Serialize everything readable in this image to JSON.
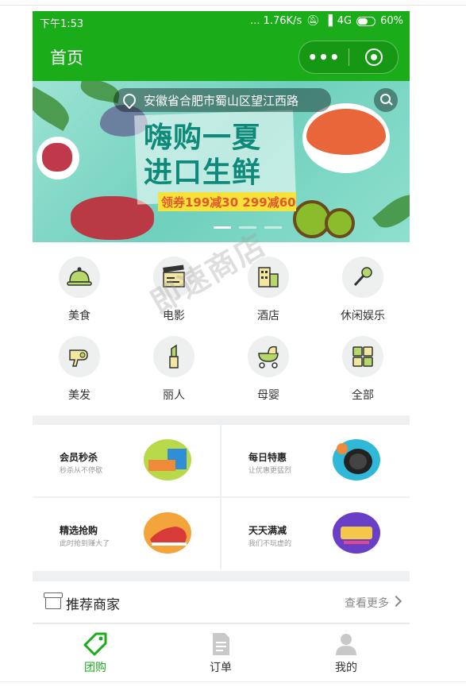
{
  "status_bar": {
    "time": "下午1:53",
    "signal_text": "... 1.76K/s",
    "network": "4G",
    "battery": "60%"
  },
  "nav": {
    "title": "首页",
    "more_label": "•••"
  },
  "banner": {
    "location": "安徽省合肥市蜀山区望江西路",
    "headline_line1": "嗨购一夏",
    "headline_line2": "进口生鲜",
    "coupon": "领券199减30  299减60"
  },
  "categories": [
    {
      "label": "美食",
      "icon": "food-cloche-icon"
    },
    {
      "label": "电影",
      "icon": "movie-clapper-icon"
    },
    {
      "label": "酒店",
      "icon": "hotel-building-icon"
    },
    {
      "label": "休闲娱乐",
      "icon": "microphone-icon"
    },
    {
      "label": "美发",
      "icon": "hairdryer-icon"
    },
    {
      "label": "丽人",
      "icon": "lipstick-icon"
    },
    {
      "label": "母婴",
      "icon": "stroller-icon"
    },
    {
      "label": "全部",
      "icon": "grid-icon"
    }
  ],
  "promos": [
    {
      "title": "会员秒杀",
      "subtitle": "秒杀从不停歇"
    },
    {
      "title": "每日特惠",
      "subtitle": "让优惠更猛烈"
    },
    {
      "title": "精选抢购",
      "subtitle": "此时抢到赚大了"
    },
    {
      "title": "天天满减",
      "subtitle": "我们不玩虚的"
    }
  ],
  "recommend": {
    "title": "推荐商家",
    "more": "查看更多"
  },
  "watermark": "即速商店",
  "tabs": [
    {
      "label": "团购",
      "icon": "tag-icon"
    },
    {
      "label": "订单",
      "icon": "document-icon"
    },
    {
      "label": "我的",
      "icon": "user-icon"
    }
  ],
  "colors": {
    "brand_green": "#1aad19",
    "text": "#222222",
    "muted": "#999999"
  }
}
